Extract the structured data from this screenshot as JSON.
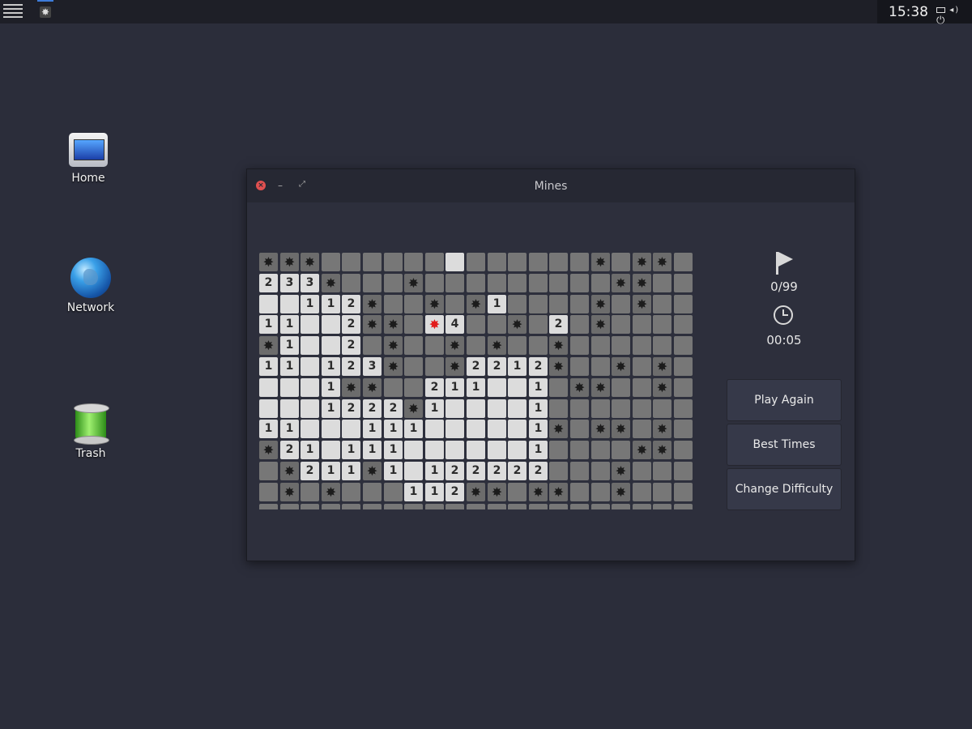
{
  "panel": {
    "clock": "15:38"
  },
  "desktop": {
    "icons": [
      {
        "label": "Home"
      },
      {
        "label": "Network"
      },
      {
        "label": "Trash"
      }
    ]
  },
  "window": {
    "title": "Mines"
  },
  "game": {
    "flags": "0/99",
    "time": "00:05",
    "buttons": {
      "play_again": "Play Again",
      "best_times": "Best Times",
      "change_difficulty": "Change Difficulty"
    },
    "legend": "Grid rows: '#'=unopened, '.'=open empty, digit=number, '*'=mine, 'X'=exploded mine",
    "grid": [
      "***######.######*#**#",
      "233*###*#########**##",
      "..112*##*#*1####*#*##",
      "11..2**#X4##*#2#*####",
      "*1..2#*##*#*##*######",
      "11.123*##*2212*##*#*#",
      "...1**##211..1#**##*#",
      "...1222*1....1#######",
      "11...111.....1*#**#*#",
      "*21.111......1####**#",
      "#*211*1.122222###*###",
      "#*#*###112**#**##*###",
      "#####################"
    ]
  }
}
